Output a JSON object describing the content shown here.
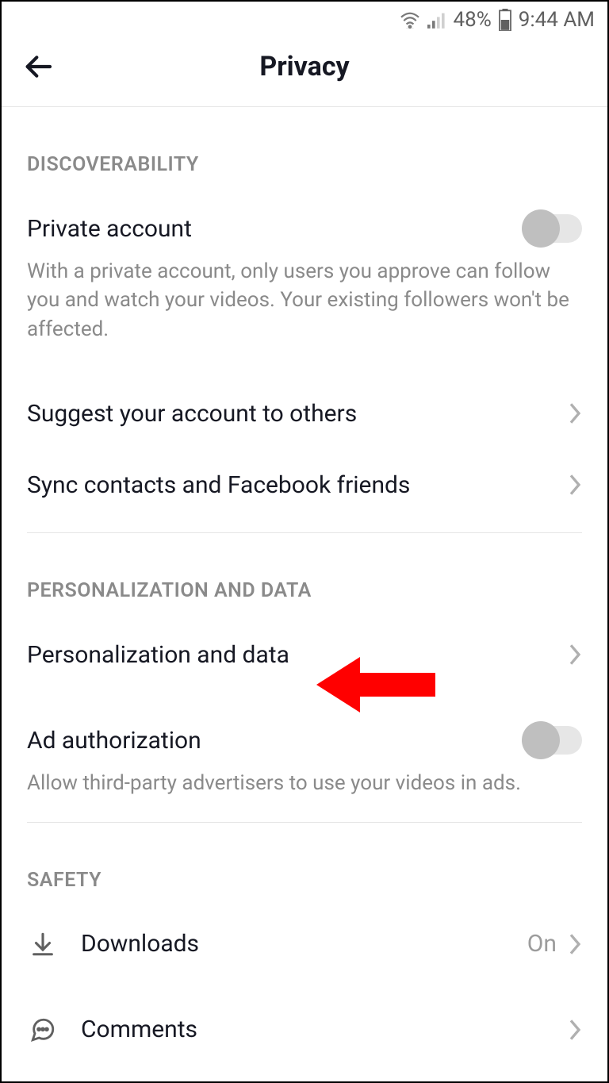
{
  "status_bar": {
    "battery_percent": "48%",
    "time": "9:44 AM"
  },
  "header": {
    "title": "Privacy"
  },
  "sections": {
    "discoverability": {
      "header": "DISCOVERABILITY",
      "private_account": {
        "label": "Private account",
        "description": "With a private account, only users you approve can follow you and watch your videos. Your existing followers won't be affected."
      },
      "suggest": {
        "label": "Suggest your account to others"
      },
      "sync": {
        "label": "Sync contacts and Facebook friends"
      }
    },
    "personalization": {
      "header": "PERSONALIZATION AND DATA",
      "personalization_data": {
        "label": "Personalization and data"
      },
      "ad_auth": {
        "label": "Ad authorization",
        "description": "Allow third-party advertisers to use your videos in ads."
      }
    },
    "safety": {
      "header": "SAFETY",
      "downloads": {
        "label": "Downloads",
        "value": "On"
      },
      "comments": {
        "label": "Comments"
      }
    }
  }
}
